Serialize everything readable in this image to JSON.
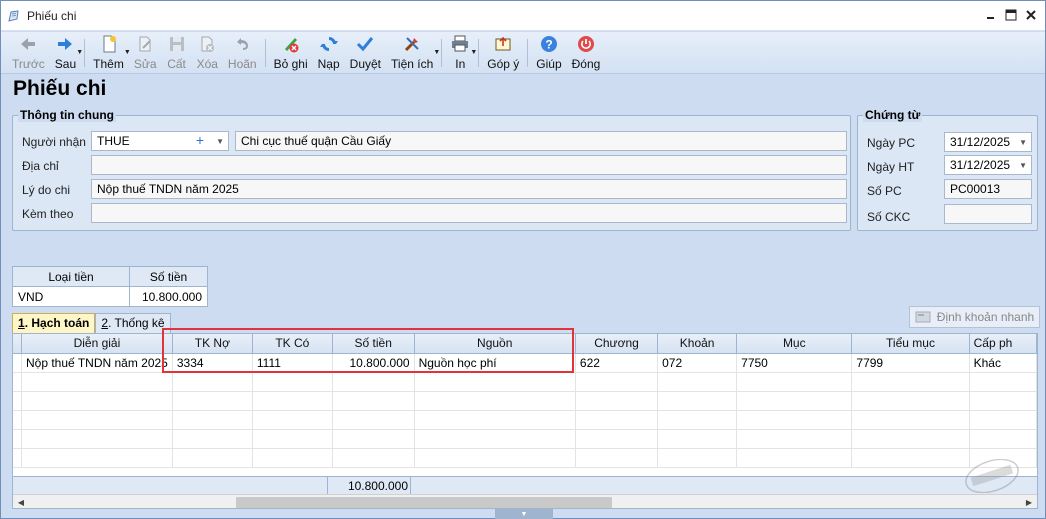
{
  "window": {
    "title": "Phiếu chi"
  },
  "toolbar": {
    "buttons": [
      {
        "key": "back",
        "label": "Trước",
        "disabled": true,
        "icon": "arrow-left-icon"
      },
      {
        "key": "next",
        "label": "Sau",
        "disabled": false,
        "icon": "arrow-right-icon"
      },
      {
        "key": "add",
        "label": "Thêm",
        "disabled": false,
        "icon": "new-document-icon"
      },
      {
        "key": "edit",
        "label": "Sửa",
        "disabled": true,
        "icon": "edit-icon"
      },
      {
        "key": "save",
        "label": "Cất",
        "disabled": true,
        "icon": "save-icon"
      },
      {
        "key": "delete",
        "label": "Xóa",
        "disabled": true,
        "icon": "delete-icon"
      },
      {
        "key": "undo",
        "label": "Hoãn",
        "disabled": true,
        "icon": "undo-icon"
      },
      {
        "key": "unpost",
        "label": "Bỏ ghi",
        "disabled": false,
        "icon": "unpost-icon"
      },
      {
        "key": "reload",
        "label": "Nạp",
        "disabled": false,
        "icon": "reload-icon"
      },
      {
        "key": "approve",
        "label": "Duyệt",
        "disabled": false,
        "icon": "check-icon"
      },
      {
        "key": "utilities",
        "label": "Tiện ích",
        "disabled": false,
        "icon": "tools-icon"
      },
      {
        "key": "print",
        "label": "In",
        "disabled": false,
        "icon": "printer-icon"
      },
      {
        "key": "feedback",
        "label": "Góp ý",
        "disabled": false,
        "icon": "feedback-icon"
      },
      {
        "key": "help",
        "label": "Giúp",
        "disabled": false,
        "icon": "help-icon"
      },
      {
        "key": "close",
        "label": "Đóng",
        "disabled": false,
        "icon": "power-icon"
      }
    ]
  },
  "page": {
    "title": "Phiếu chi"
  },
  "general": {
    "title": "Thông tin chung",
    "recipient_label": "Người nhận",
    "recipient_code": "THUE",
    "recipient_name": "Chi cục thuế quận Cầu Giấy",
    "address_label": "Địa chỉ",
    "address_value": "",
    "reason_label": "Lý do chi",
    "reason_value": "Nộp thuế TNDN năm 2025",
    "attach_label": "Kèm theo",
    "attach_value": ""
  },
  "voucher": {
    "title": "Chứng từ",
    "date_pc_label": "Ngày PC",
    "date_pc_value": "31/12/2025",
    "date_ht_label": "Ngày HT",
    "date_ht_value": "31/12/2025",
    "so_pc_label": "Số PC",
    "so_pc_value": "PC00013",
    "so_ckc_label": "Số CKC",
    "so_ckc_value": ""
  },
  "currency": {
    "type_header": "Loại tiền",
    "amount_header": "Số tiền",
    "type_value": "VND",
    "amount_value": "10.800.000"
  },
  "tabs": [
    {
      "key": "1",
      "label": "Hạch toán",
      "active": true
    },
    {
      "key": "2",
      "label": "Thống kê",
      "active": false
    }
  ],
  "quick_button": {
    "label": "Định khoản nhanh"
  },
  "grid": {
    "columns": [
      "Diễn giải",
      "TK Nợ",
      "TK Có",
      "Số tiền",
      "Nguồn",
      "Chương",
      "Khoản",
      "Mục",
      "Tiểu mục",
      "Cấp ph"
    ],
    "rows": [
      [
        "Nộp thuế TNDN năm 2025",
        "3334",
        "1111",
        "10.800.000",
        "Nguồn học phí",
        "622",
        "072",
        "7750",
        "7799",
        "Khác"
      ]
    ],
    "total": "10.800.000"
  },
  "colors": {
    "highlight_box": "#e0343a",
    "active_tab": "#fff6c8"
  }
}
